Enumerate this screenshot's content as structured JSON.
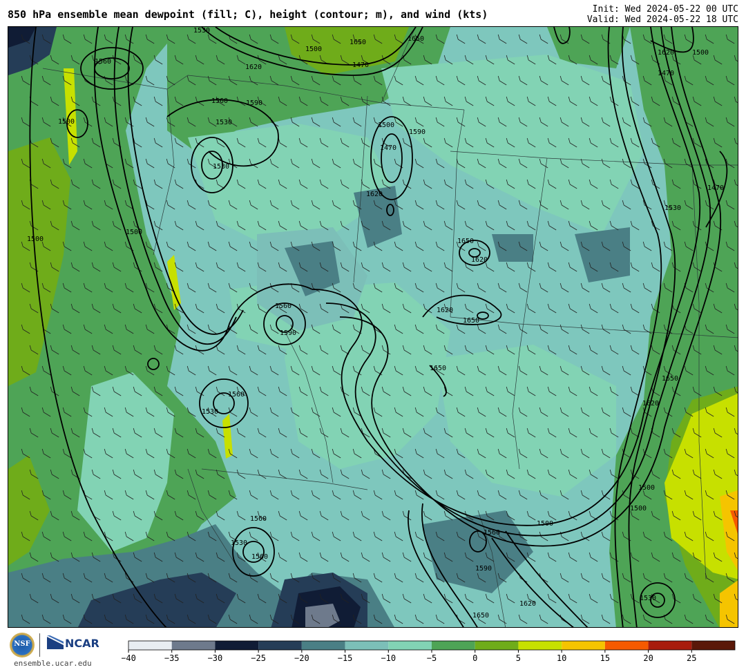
{
  "header": {
    "title": "850 hPa ensemble mean dewpoint (fill; C), height (contour; m), and wind (kts)",
    "init": "Init: Wed 2024-05-22 00 UTC",
    "valid": "Valid: Wed 2024-05-22 18 UTC"
  },
  "footer": {
    "nsf_logo_text": "NSF",
    "ncar_logo_text": "NCAR",
    "site_url": "ensemble.ucar.edu"
  },
  "colorbar": {
    "ticks": [
      -40,
      -35,
      -30,
      -25,
      -20,
      -15,
      -10,
      -5,
      0,
      5,
      10,
      15,
      20,
      25
    ],
    "tick_labels": [
      "−40",
      "−35",
      "−30",
      "−25",
      "−20",
      "−15",
      "−10",
      "−5",
      "0",
      "5",
      "10",
      "15",
      "20",
      "25"
    ],
    "colors": [
      "#e8edf2",
      "#6e7a8c",
      "#101c35",
      "#253d57",
      "#4a7f85",
      "#7cbfb8",
      "#82d3b4",
      "#4ea456",
      "#6fac1a",
      "#c7e000",
      "#f5c400",
      "#f55a00",
      "#a81c0c",
      "#5a1808"
    ],
    "range": [
      -40,
      30
    ]
  },
  "map": {
    "contour_labels": [
      {
        "text": "1560"
      },
      {
        "text": "1530"
      },
      {
        "text": "1650"
      },
      {
        "text": "1470"
      },
      {
        "text": "1500"
      },
      {
        "text": "1620"
      },
      {
        "text": "1590"
      },
      {
        "text": "1560"
      },
      {
        "text": "1530"
      },
      {
        "text": "1500"
      },
      {
        "text": "1500"
      },
      {
        "text": "1530"
      },
      {
        "text": "1590"
      },
      {
        "text": "1470"
      },
      {
        "text": "1500"
      },
      {
        "text": "1620"
      },
      {
        "text": "1650"
      },
      {
        "text": "1620"
      },
      {
        "text": "1620"
      },
      {
        "text": "1650"
      },
      {
        "text": "1560"
      },
      {
        "text": "1590"
      },
      {
        "text": "1650"
      },
      {
        "text": "1560"
      },
      {
        "text": "1530"
      },
      {
        "text": "1560"
      },
      {
        "text": "1530"
      },
      {
        "text": "1560"
      },
      {
        "text": "1500"
      },
      {
        "text": "1560"
      },
      {
        "text": "1590"
      },
      {
        "text": "1650"
      },
      {
        "text": "1620"
      },
      {
        "text": "1650"
      },
      {
        "text": "1620"
      },
      {
        "text": "1500"
      },
      {
        "text": "1500"
      },
      {
        "text": "1530"
      },
      {
        "text": "1530"
      },
      {
        "text": "1470"
      },
      {
        "text": "1500"
      },
      {
        "text": "1620"
      },
      {
        "text": "1650"
      },
      {
        "text": "1500"
      },
      {
        "text": "1470"
      }
    ]
  }
}
